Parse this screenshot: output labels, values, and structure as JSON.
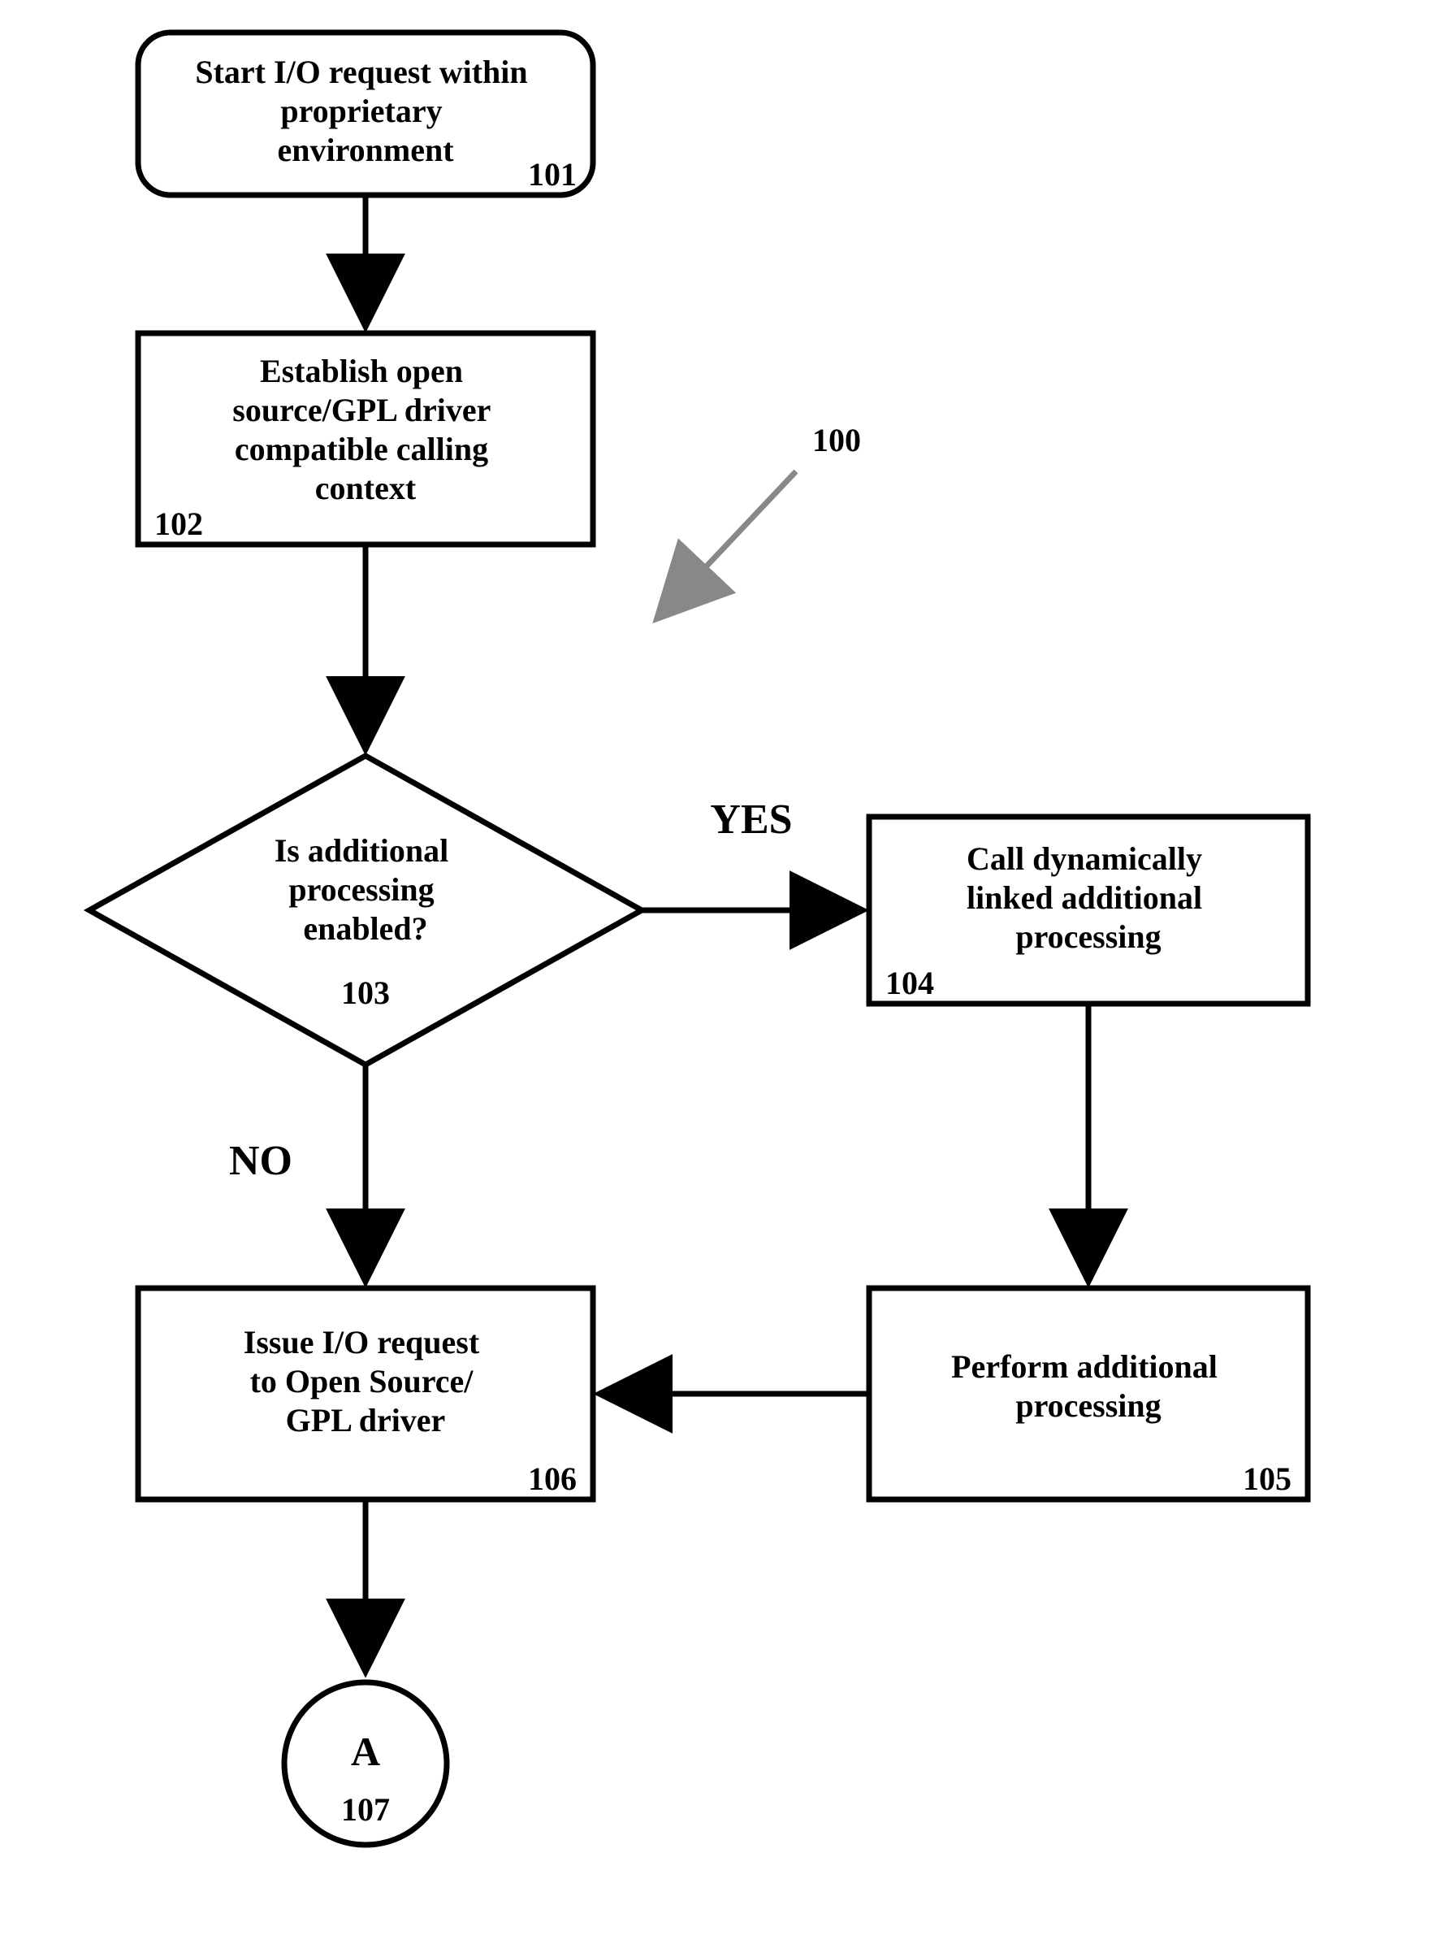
{
  "chart_data": {
    "type": "flowchart",
    "figure_ref": "100",
    "nodes": [
      {
        "id": "101",
        "shape": "terminator",
        "text_lines": [
          "Start I/O request within",
          "proprietary",
          "environment"
        ],
        "ref": "101"
      },
      {
        "id": "102",
        "shape": "process",
        "text_lines": [
          "Establish open",
          "source/GPL driver",
          "compatible calling",
          "context"
        ],
        "ref": "102"
      },
      {
        "id": "103",
        "shape": "decision",
        "text_lines": [
          "Is additional",
          "processing",
          "enabled?"
        ],
        "ref": "103"
      },
      {
        "id": "104",
        "shape": "process",
        "text_lines": [
          "Call dynamically",
          "linked additional",
          "processing"
        ],
        "ref": "104"
      },
      {
        "id": "105",
        "shape": "process",
        "text_lines": [
          "Perform additional",
          "processing"
        ],
        "ref": "105"
      },
      {
        "id": "106",
        "shape": "process",
        "text_lines": [
          "Issue I/O request",
          "to Open Source/",
          "GPL driver"
        ],
        "ref": "106"
      },
      {
        "id": "107",
        "shape": "connector",
        "text_lines": [
          "A"
        ],
        "ref": "107"
      }
    ],
    "edges": [
      {
        "from": "101",
        "to": "102",
        "label": ""
      },
      {
        "from": "102",
        "to": "103",
        "label": ""
      },
      {
        "from": "103",
        "to": "104",
        "label": "YES"
      },
      {
        "from": "103",
        "to": "106",
        "label": "NO"
      },
      {
        "from": "104",
        "to": "105",
        "label": ""
      },
      {
        "from": "105",
        "to": "106",
        "label": ""
      },
      {
        "from": "106",
        "to": "107",
        "label": ""
      }
    ]
  },
  "labels": {
    "yes": "YES",
    "no": "NO",
    "fig_ref": "100",
    "connector_letter": "A"
  },
  "node_text": {
    "n101_l1": "Start I/O request within",
    "n101_l2": "proprietary",
    "n101_l3": "environment",
    "n101_ref": "101",
    "n102_l1": "Establish open",
    "n102_l2": "source/GPL driver",
    "n102_l3": "compatible calling",
    "n102_l4": "context",
    "n102_ref": "102",
    "n103_l1": "Is additional",
    "n103_l2": "processing",
    "n103_l3": "enabled?",
    "n103_ref": "103",
    "n104_l1": "Call dynamically",
    "n104_l2": "linked additional",
    "n104_l3": "processing",
    "n104_ref": "104",
    "n105_l1": "Perform additional",
    "n105_l2": "processing",
    "n105_ref": "105",
    "n106_l1": "Issue I/O request",
    "n106_l2": "to Open Source/",
    "n106_l3": "GPL driver",
    "n106_ref": "106",
    "n107_ref": "107"
  }
}
